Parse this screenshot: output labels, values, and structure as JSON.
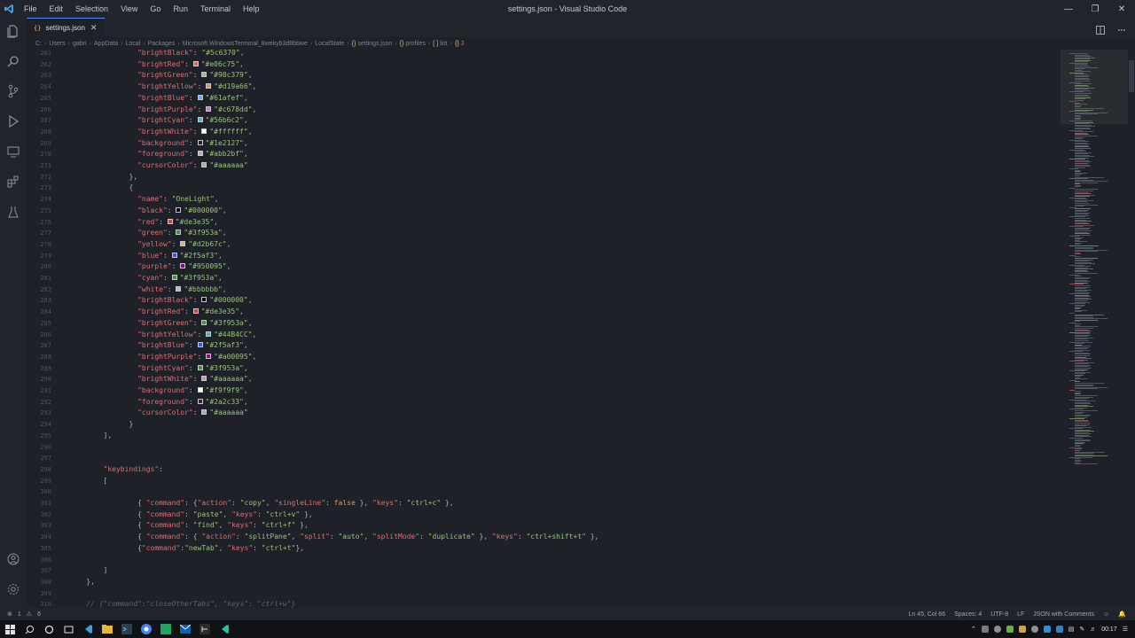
{
  "window": {
    "title": "settings.json - Visual Studio Code",
    "menu": [
      "File",
      "Edit",
      "Selection",
      "View",
      "Go",
      "Run",
      "Terminal",
      "Help"
    ]
  },
  "tab": {
    "label": "settings.json"
  },
  "breadcrumb": [
    "C:",
    "Users",
    "gabri",
    "AppData",
    "Local",
    "Packages",
    "Microsoft.WindowsTerminal_8wekyb3d8bbwe",
    "LocalState",
    "settings.json",
    "profiles",
    "list",
    "3"
  ],
  "colors": {
    "editor_bg": "#1e2127",
    "key": "#e06c75",
    "string": "#98c379",
    "accent": "#528bff"
  },
  "editor": {
    "lines": [
      {
        "n": "261",
        "indent": 8,
        "key": "brightBlack",
        "val": "#5c6370"
      },
      {
        "n": "262",
        "indent": 8,
        "key": "brightRed",
        "val": "#e06c75",
        "sw": "#e06c75"
      },
      {
        "n": "263",
        "indent": 8,
        "key": "brightGreen",
        "val": "#98c379",
        "sw": "#98c379"
      },
      {
        "n": "264",
        "indent": 8,
        "key": "brightYellow",
        "val": "#d19a66",
        "sw": "#d19a66"
      },
      {
        "n": "265",
        "indent": 8,
        "key": "brightBlue",
        "val": "#61afef",
        "sw": "#61afef"
      },
      {
        "n": "266",
        "indent": 8,
        "key": "brightPurple",
        "val": "#c678dd",
        "sw": "#c678dd"
      },
      {
        "n": "267",
        "indent": 8,
        "key": "brightCyan",
        "val": "#56b6c2",
        "sw": "#56b6c2"
      },
      {
        "n": "268",
        "indent": 8,
        "key": "brightWhite",
        "val": "#ffffff",
        "sw": "#ffffff"
      },
      {
        "n": "269",
        "indent": 8,
        "key": "background",
        "val": "#1e2127",
        "sw": "#1e2127"
      },
      {
        "n": "270",
        "indent": 8,
        "key": "foreground",
        "val": "#abb2bf",
        "sw": "#abb2bf"
      },
      {
        "n": "271",
        "indent": 8,
        "key": "cursorColor",
        "val": "#aaaaaa",
        "sw": "#aaaaaa",
        "last": true
      },
      {
        "n": "272",
        "indent": 7,
        "text": "},"
      },
      {
        "n": "273",
        "indent": 7,
        "text": "{"
      },
      {
        "n": "274",
        "indent": 8,
        "key": "name",
        "val": "OneLight"
      },
      {
        "n": "275",
        "indent": 8,
        "key": "black",
        "val": "#000000",
        "sw": "#000000"
      },
      {
        "n": "276",
        "indent": 8,
        "key": "red",
        "val": "#de3e35",
        "sw": "#de3e35"
      },
      {
        "n": "277",
        "indent": 8,
        "key": "green",
        "val": "#3f953a",
        "sw": "#3f953a"
      },
      {
        "n": "278",
        "indent": 8,
        "key": "yellow",
        "val": "#d2b67c",
        "sw": "#d2b67c"
      },
      {
        "n": "279",
        "indent": 8,
        "key": "blue",
        "val": "#2f5af3",
        "sw": "#2f5af3"
      },
      {
        "n": "280",
        "indent": 8,
        "key": "purple",
        "val": "#950095",
        "sw": "#950095"
      },
      {
        "n": "281",
        "indent": 8,
        "key": "cyan",
        "val": "#3f953a",
        "sw": "#3f953a"
      },
      {
        "n": "282",
        "indent": 8,
        "key": "white",
        "val": "#bbbbbb",
        "sw": "#bbbbbb"
      },
      {
        "n": "283",
        "indent": 8,
        "key": "brightBlack",
        "val": "#000000",
        "sw": "#000000"
      },
      {
        "n": "284",
        "indent": 8,
        "key": "brightRed",
        "val": "#de3e35",
        "sw": "#de3e35"
      },
      {
        "n": "285",
        "indent": 8,
        "key": "brightGreen",
        "val": "#3f953a",
        "sw": "#3f953a"
      },
      {
        "n": "286",
        "indent": 8,
        "key": "brightYellow",
        "val": "#44B4CC",
        "sw": "#44B4CC"
      },
      {
        "n": "287",
        "indent": 8,
        "key": "brightBlue",
        "val": "#2f5af3",
        "sw": "#2f5af3"
      },
      {
        "n": "288",
        "indent": 8,
        "key": "brightPurple",
        "val": "#a00095",
        "sw": "#a00095"
      },
      {
        "n": "289",
        "indent": 8,
        "key": "brightCyan",
        "val": "#3f953a",
        "sw": "#3f953a"
      },
      {
        "n": "290",
        "indent": 8,
        "key": "brightWhite",
        "val": "#aaaaaa",
        "sw": "#aaaaaa"
      },
      {
        "n": "291",
        "indent": 8,
        "key": "background",
        "val": "#f9f9f9",
        "sw": "#f9f9f9"
      },
      {
        "n": "292",
        "indent": 8,
        "key": "foreground",
        "val": "#2a2c33",
        "sw": "#2a2c33"
      },
      {
        "n": "293",
        "indent": 8,
        "key": "cursorColor",
        "val": "#aaaaaa",
        "sw": "#aaaaaa",
        "last": true
      },
      {
        "n": "294",
        "indent": 7,
        "text": "}"
      },
      {
        "n": "295",
        "indent": 4,
        "text": "],"
      },
      {
        "n": "296",
        "indent": 0,
        "text": ""
      },
      {
        "n": "297",
        "indent": 0,
        "text": ""
      },
      {
        "n": "298",
        "indent": 4,
        "key": "keybindings",
        "val": null
      },
      {
        "n": "299",
        "indent": 4,
        "text": "["
      },
      {
        "n": "300",
        "indent": 0,
        "text": ""
      },
      {
        "n": "301",
        "indent": 8,
        "text": "{ \"command\": {\"action\": \"copy\", \"singleLine\": false }, \"keys\": \"ctrl+c\" },"
      },
      {
        "n": "302",
        "indent": 8,
        "text": "{ \"command\": \"paste\", \"keys\": \"ctrl+v\" },"
      },
      {
        "n": "303",
        "indent": 8,
        "text": "{ \"command\": \"find\", \"keys\": \"ctrl+f\" },"
      },
      {
        "n": "304",
        "indent": 8,
        "text": "{ \"command\": { \"action\": \"splitPane\", \"split\": \"auto\", \"splitMode\": \"duplicate\" }, \"keys\": \"ctrl+shift+t\" },"
      },
      {
        "n": "305",
        "indent": 8,
        "text": "{\"command\":\"newTab\", \"keys\": \"ctrl+t\"},"
      },
      {
        "n": "306",
        "indent": 0,
        "text": ""
      },
      {
        "n": "307",
        "indent": 4,
        "text": "]"
      },
      {
        "n": "308",
        "indent": 2,
        "text": "},"
      },
      {
        "n": "309",
        "indent": 0,
        "text": ""
      },
      {
        "n": "310",
        "indent": 2,
        "text": "// {\"command\":\"closeOtherTabs\", \"keys\": \"ctrl+w\"}",
        "comment": true
      }
    ]
  },
  "status": {
    "errors": "1",
    "warnings": "6",
    "position": "Ln 45, Col 66",
    "spaces": "Spaces: 4",
    "encoding": "UTF-8",
    "eol": "LF",
    "language": "JSON with Comments"
  },
  "taskbar": {
    "time": "00:17"
  }
}
